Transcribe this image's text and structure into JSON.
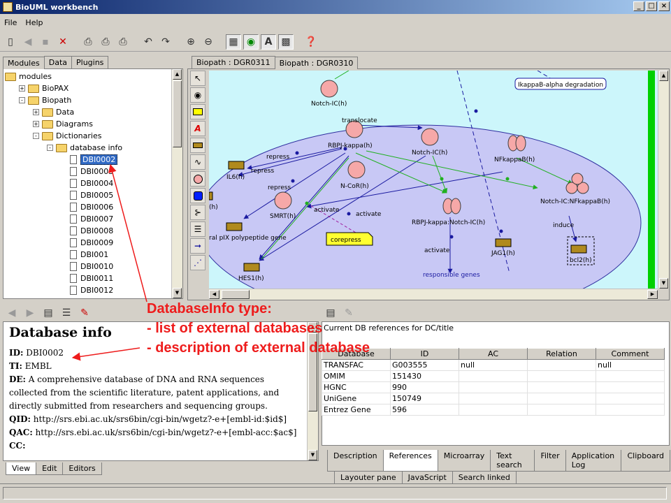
{
  "window": {
    "title": "BioUML workbench"
  },
  "menu": [
    "File",
    "Help"
  ],
  "modules_panel": {
    "tabs": [
      "Modules",
      "Data",
      "Plugins"
    ],
    "tree": [
      {
        "label": "modules",
        "level": 0,
        "type": "folder-open",
        "exp": ""
      },
      {
        "label": "BioPAX",
        "level": 1,
        "type": "folder",
        "exp": "+"
      },
      {
        "label": "Biopath",
        "level": 1,
        "type": "folder-open",
        "exp": "-"
      },
      {
        "label": "Data",
        "level": 2,
        "type": "folder",
        "exp": "+"
      },
      {
        "label": "Diagrams",
        "level": 2,
        "type": "folder",
        "exp": "+"
      },
      {
        "label": "Dictionaries",
        "level": 2,
        "type": "folder-open",
        "exp": "-"
      },
      {
        "label": "database info",
        "level": 3,
        "type": "folder-open",
        "exp": "-"
      },
      {
        "label": "DBI0002",
        "level": 4,
        "type": "doc",
        "exp": "",
        "selected": true
      },
      {
        "label": "DBI0003",
        "level": 4,
        "type": "doc",
        "exp": ""
      },
      {
        "label": "DBI0004",
        "level": 4,
        "type": "doc",
        "exp": ""
      },
      {
        "label": "DBI0005",
        "level": 4,
        "type": "doc",
        "exp": ""
      },
      {
        "label": "DBI0006",
        "level": 4,
        "type": "doc",
        "exp": ""
      },
      {
        "label": "DBI0007",
        "level": 4,
        "type": "doc",
        "exp": ""
      },
      {
        "label": "DBI0008",
        "level": 4,
        "type": "doc",
        "exp": ""
      },
      {
        "label": "DBI0009",
        "level": 4,
        "type": "doc",
        "exp": ""
      },
      {
        "label": "DBI001",
        "level": 4,
        "type": "doc",
        "exp": ""
      },
      {
        "label": "DBI0010",
        "level": 4,
        "type": "doc",
        "exp": ""
      },
      {
        "label": "DBI0011",
        "level": 4,
        "type": "doc",
        "exp": ""
      },
      {
        "label": "DBI0012",
        "level": 4,
        "type": "doc",
        "exp": ""
      }
    ]
  },
  "diagram_panel": {
    "tabs": [
      "Biopath : DGR0311",
      "Biopath : DGR0310"
    ],
    "nodes": {
      "notch_ic_top": "Notch-IC(h)",
      "rbpj_kappa": "RBPJ-kappa(h)",
      "notch_ic_mid": "Notch-IC(h)",
      "nfkappab": "NFkappaB(h)",
      "n_cor": "N-CoR(h)",
      "smrt": "SMRT(h)",
      "il6": "IL6(h)",
      "rbpj_notch": "RBPJ-kappa:Notch-IC(h)",
      "notch_nfkappab": "Notch-IC:NFkappaB(h)",
      "polypeptide": "ral pIX polypeptide gene",
      "hes1": "HES1(h)",
      "jag1": "JAG1(h)",
      "bcl2": "bcl2(h)",
      "h_left": "(h)",
      "responsible": "responsible genes",
      "ikappab": "IkappaB-alpha degradation",
      "corepress": "corepress"
    },
    "edge_labels": {
      "translocate": "translocate",
      "repress1": "repress",
      "repress2": "repress",
      "repress3": "repress",
      "activate1": "activate",
      "activate2": "activate",
      "activate3": "activate",
      "induce": "induce"
    }
  },
  "info_panel": {
    "heading": "Database info",
    "fields": [
      {
        "key": "ID:",
        "value": " DBI0002"
      },
      {
        "key": "TI:",
        "value": " EMBL"
      },
      {
        "key": "DE:",
        "value": " A comprehensive database of DNA and RNA sequences collected from the scientific literature, patent applications, and directly submitted from researchers and sequencing groups."
      },
      {
        "key": "QID:",
        "value": " http://srs.ebi.ac.uk/srs6bin/cgi-bin/wgetz?-e+[embl-id:$id$]"
      },
      {
        "key": "QAC:",
        "value": " http://srs.ebi.ac.uk/srs6bin/cgi-bin/wgetz?-e+[embl-acc:$ac$]"
      },
      {
        "key": "CC:",
        "value": ""
      }
    ],
    "tabs": [
      "View",
      "Edit",
      "Editors"
    ]
  },
  "references_panel": {
    "caption": "Current DB references for DC/title",
    "columns": [
      "Database",
      "ID",
      "AC",
      "Relation",
      "Comment"
    ],
    "rows": [
      [
        "TRANSFAC",
        "G003555",
        "null",
        "",
        "null"
      ],
      [
        "OMIM",
        "151430",
        "",
        "",
        ""
      ],
      [
        "HGNC",
        "990",
        "",
        "",
        ""
      ],
      [
        "UniGene",
        "150749",
        "",
        "",
        ""
      ],
      [
        "Entrez Gene",
        "596",
        "",
        "",
        ""
      ]
    ],
    "tabs_row1": [
      "Description",
      "References",
      "Microarray",
      "Text search",
      "Filter",
      "Application Log",
      "Clipboard"
    ],
    "tabs_row2": [
      "Layouter pane",
      "JavaScript",
      "Search linked"
    ]
  },
  "annotation": {
    "lines": [
      "DatabaseInfo type:",
      "- list of external databases",
      "- description of external database"
    ]
  },
  "colors": {
    "annotation": "#ee1c1c",
    "canvas_bg": "#ccf6fb",
    "cell": "#c8c8f5",
    "protein": "#f6a8a8",
    "gene": "#b08a1e",
    "edge_green": "#20b020",
    "edge_blue": "#1a1aa0"
  }
}
